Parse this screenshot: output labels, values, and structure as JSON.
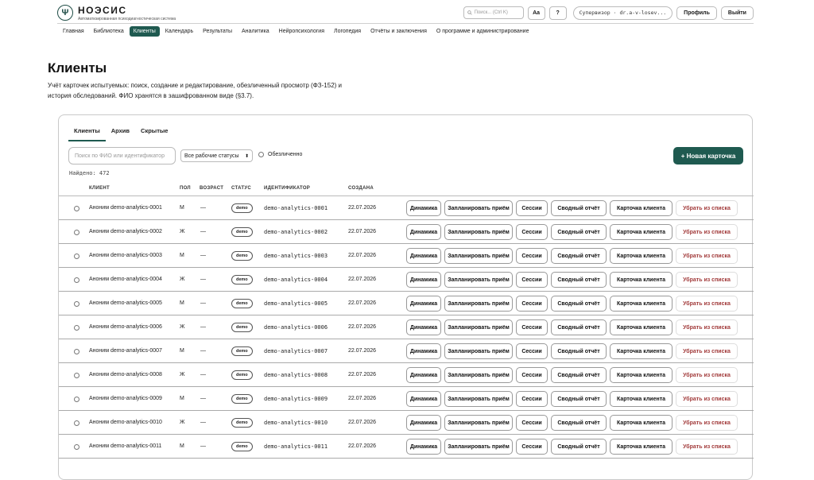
{
  "header": {
    "brand_title": "НОЭСИС",
    "brand_subtitle": "Автоматизированная психодиагностическая система",
    "logo_glyph": "Ψ",
    "search_placeholder": "Поиск... (Ctrl K)",
    "font_button": "Aa",
    "help_button": "?",
    "user": "Супервизор · dr.a-v-losev...",
    "profile_button": "Профиль",
    "logout_button": "Выйти"
  },
  "nav": {
    "items": [
      "Главная",
      "Библиотека",
      "Клиенты",
      "Календарь",
      "Результаты",
      "Аналитика",
      "Нейропсихология",
      "Логопедия",
      "Отчёты и заключения",
      "О программе и администрирование"
    ],
    "active_index": 2
  },
  "page": {
    "title": "Клиенты",
    "description": "Учёт карточек испытуемых: поиск, создание и редактирование, обезличенный просмотр (ФЗ-152) и история обследований. ФИО хранятся в зашифрованном виде (§3.7)."
  },
  "tabs": [
    "Клиенты",
    "Архив",
    "Скрытые"
  ],
  "filters": {
    "search_placeholder": "Поиск по ФИО или идентификатор",
    "status_select": "Все рабочие статусы",
    "anonymized_label": "Обезличенно",
    "new_card_button": "+ Новая карточка",
    "found": "Найдено: 472"
  },
  "table": {
    "headers": [
      "КЛИЕНТ",
      "ПОЛ",
      "ВОЗРАСТ",
      "СТАТУС",
      "ИДЕНТИФИКАТОР",
      "СОЗДАНА"
    ],
    "actions": [
      "Динамика",
      "Запланировать приём",
      "Сессии",
      "Сводный отчёт",
      "Карточка клиента",
      "Убрать из списка"
    ],
    "rows": [
      {
        "client": "Аноним demo-analytics-0001",
        "sex": "М",
        "age": "—",
        "status": "demo",
        "id": "demo-analytics-0001",
        "created": "22.07.2026"
      },
      {
        "client": "Аноним demo-analytics-0002",
        "sex": "Ж",
        "age": "—",
        "status": "demo",
        "id": "demo-analytics-0002",
        "created": "22.07.2026"
      },
      {
        "client": "Аноним demo-analytics-0003",
        "sex": "М",
        "age": "—",
        "status": "demo",
        "id": "demo-analytics-0003",
        "created": "22.07.2026"
      },
      {
        "client": "Аноним demo-analytics-0004",
        "sex": "Ж",
        "age": "—",
        "status": "demo",
        "id": "demo-analytics-0004",
        "created": "22.07.2026"
      },
      {
        "client": "Аноним demo-analytics-0005",
        "sex": "М",
        "age": "—",
        "status": "demo",
        "id": "demo-analytics-0005",
        "created": "22.07.2026"
      },
      {
        "client": "Аноним demo-analytics-0006",
        "sex": "Ж",
        "age": "—",
        "status": "demo",
        "id": "demo-analytics-0006",
        "created": "22.07.2026"
      },
      {
        "client": "Аноним demo-analytics-0007",
        "sex": "М",
        "age": "—",
        "status": "demo",
        "id": "demo-analytics-0007",
        "created": "22.07.2026"
      },
      {
        "client": "Аноним demo-analytics-0008",
        "sex": "Ж",
        "age": "—",
        "status": "demo",
        "id": "demo-analytics-0008",
        "created": "22.07.2026"
      },
      {
        "client": "Аноним demo-analytics-0009",
        "sex": "М",
        "age": "—",
        "status": "demo",
        "id": "demo-analytics-0009",
        "created": "22.07.2026"
      },
      {
        "client": "Аноним demo-analytics-0010",
        "sex": "Ж",
        "age": "—",
        "status": "demo",
        "id": "demo-analytics-0010",
        "created": "22.07.2026"
      },
      {
        "client": "Аноним demo-analytics-0011",
        "sex": "М",
        "age": "—",
        "status": "demo",
        "id": "demo-analytics-0011",
        "created": "22.07.2026"
      }
    ]
  },
  "colors": {
    "accent": "#1f5a50",
    "danger": "#a23b3b"
  }
}
